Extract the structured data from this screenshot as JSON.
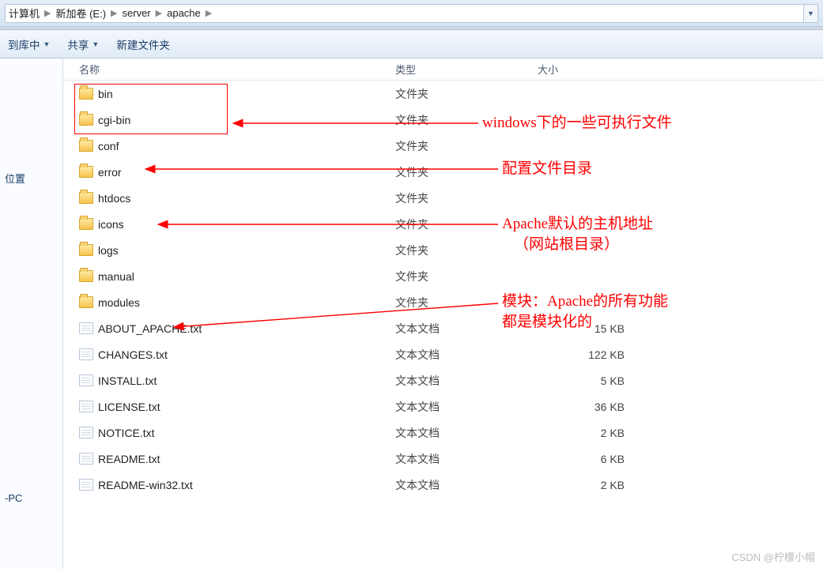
{
  "breadcrumbs": {
    "computer": "计算机",
    "volume": "新加卷 (E:)",
    "server": "server",
    "apache": "apache"
  },
  "toolbar": {
    "include_in_library": "到库中",
    "share": "共享",
    "new_folder": "新建文件夹"
  },
  "sidebar": {
    "recent_places": "位置",
    "pc_suffix": "-PC"
  },
  "columns": {
    "name": "名称",
    "type": "类型",
    "size": "大小"
  },
  "types": {
    "folder": "文件夹",
    "txt": "文本文档"
  },
  "items": [
    {
      "name": "bin",
      "kind": "folder",
      "size": ""
    },
    {
      "name": "cgi-bin",
      "kind": "folder",
      "size": ""
    },
    {
      "name": "conf",
      "kind": "folder",
      "size": ""
    },
    {
      "name": "error",
      "kind": "folder",
      "size": ""
    },
    {
      "name": "htdocs",
      "kind": "folder",
      "size": ""
    },
    {
      "name": "icons",
      "kind": "folder",
      "size": ""
    },
    {
      "name": "logs",
      "kind": "folder",
      "size": ""
    },
    {
      "name": "manual",
      "kind": "folder",
      "size": ""
    },
    {
      "name": "modules",
      "kind": "folder",
      "size": ""
    },
    {
      "name": "ABOUT_APACHE.txt",
      "kind": "txt",
      "size": "15 KB"
    },
    {
      "name": "CHANGES.txt",
      "kind": "txt",
      "size": "122 KB"
    },
    {
      "name": "INSTALL.txt",
      "kind": "txt",
      "size": "5 KB"
    },
    {
      "name": "LICENSE.txt",
      "kind": "txt",
      "size": "36 KB"
    },
    {
      "name": "NOTICE.txt",
      "kind": "txt",
      "size": "2 KB"
    },
    {
      "name": "README.txt",
      "kind": "txt",
      "size": "6 KB"
    },
    {
      "name": "README-win32.txt",
      "kind": "txt",
      "size": "2 KB"
    }
  ],
  "annotations": {
    "bin": "windows下的一些可执行文件",
    "conf": "配置文件目录",
    "htdocs1": "Apache默认的主机地址",
    "htdocs2": "（网站根目录）",
    "mod1": "模块：Apache的所有功能",
    "mod2": "都是模块化的"
  },
  "watermark": "CSDN @柠檬小帽"
}
